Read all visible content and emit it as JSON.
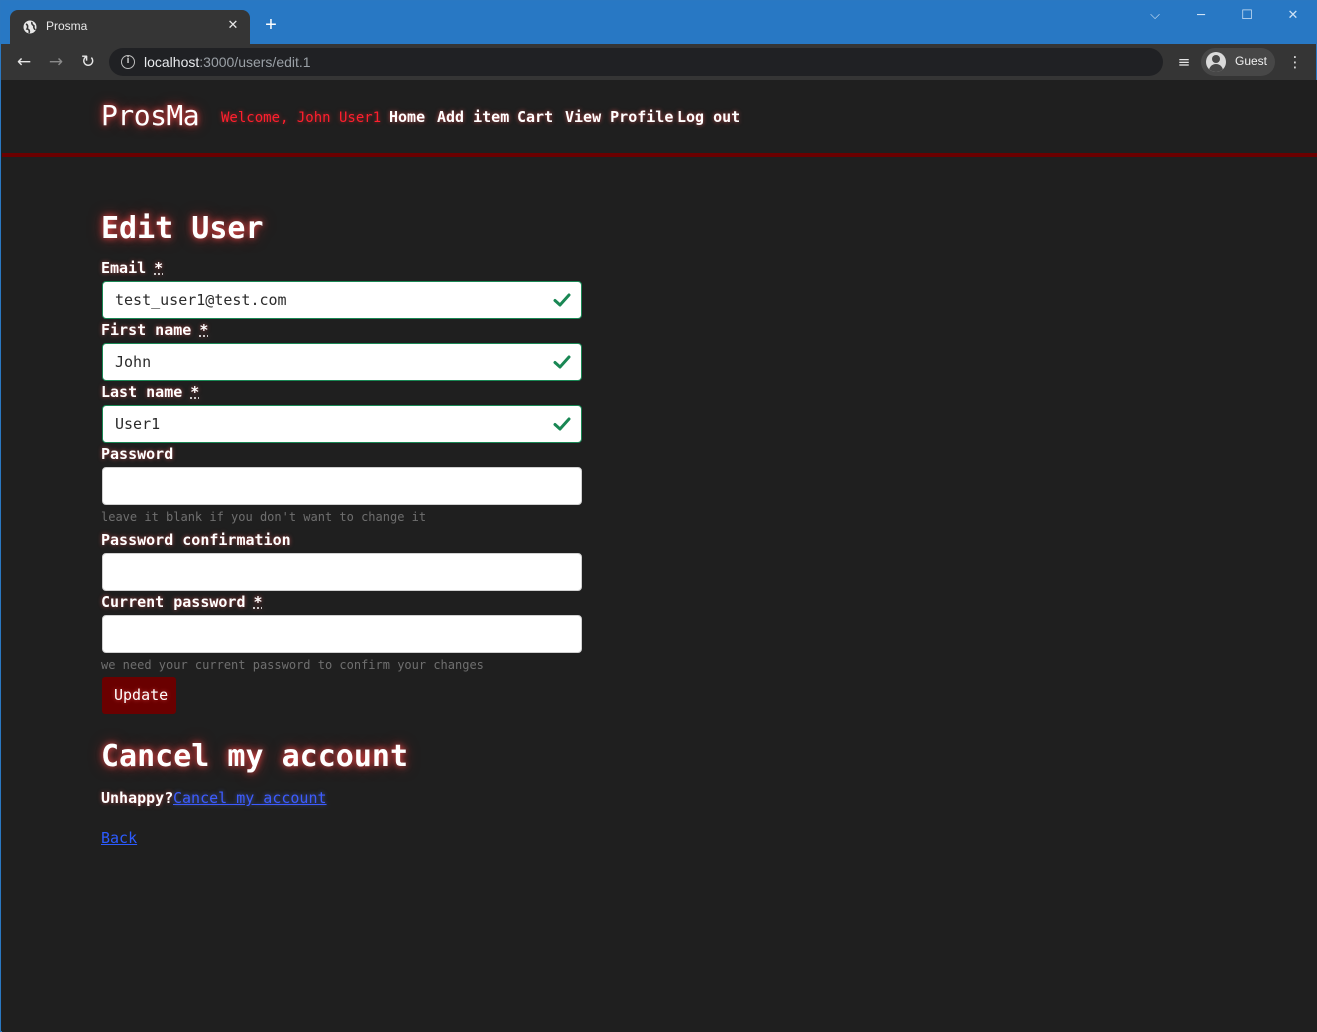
{
  "browser": {
    "tab_title": "Prosma",
    "tab_close": "✕",
    "new_tab": "+",
    "url_host": "localhost",
    "url_rest": ":3000/users/edit.1",
    "profile_label": "Guest"
  },
  "header": {
    "brand": "ProsMa",
    "welcome": "Welcome, John User1",
    "nav": [
      "Home",
      "Add item",
      "Cart",
      "View Profile",
      "Log out"
    ]
  },
  "form": {
    "title": "Edit User",
    "email_label": "Email",
    "email_value": "test_user1@test.com",
    "first_name_label": "First name",
    "first_name_value": "John",
    "last_name_label": "Last name",
    "last_name_value": "User1",
    "password_label": "Password",
    "password_hint": "leave it blank if you don't want to change it",
    "password_confirmation_label": "Password confirmation",
    "current_password_label": "Current password",
    "current_password_hint": "we need your current password to confirm your changes",
    "required_marker": "*",
    "submit_label": "Update"
  },
  "cancel": {
    "title": "Cancel my account",
    "prompt": "Unhappy?",
    "link_label": "Cancel my account"
  },
  "back_label": "Back",
  "colors": {
    "accent_red": "#6a0000",
    "valid_green": "#198754",
    "link_blue": "#2c5bff",
    "chrome_blue": "#2878c4"
  }
}
